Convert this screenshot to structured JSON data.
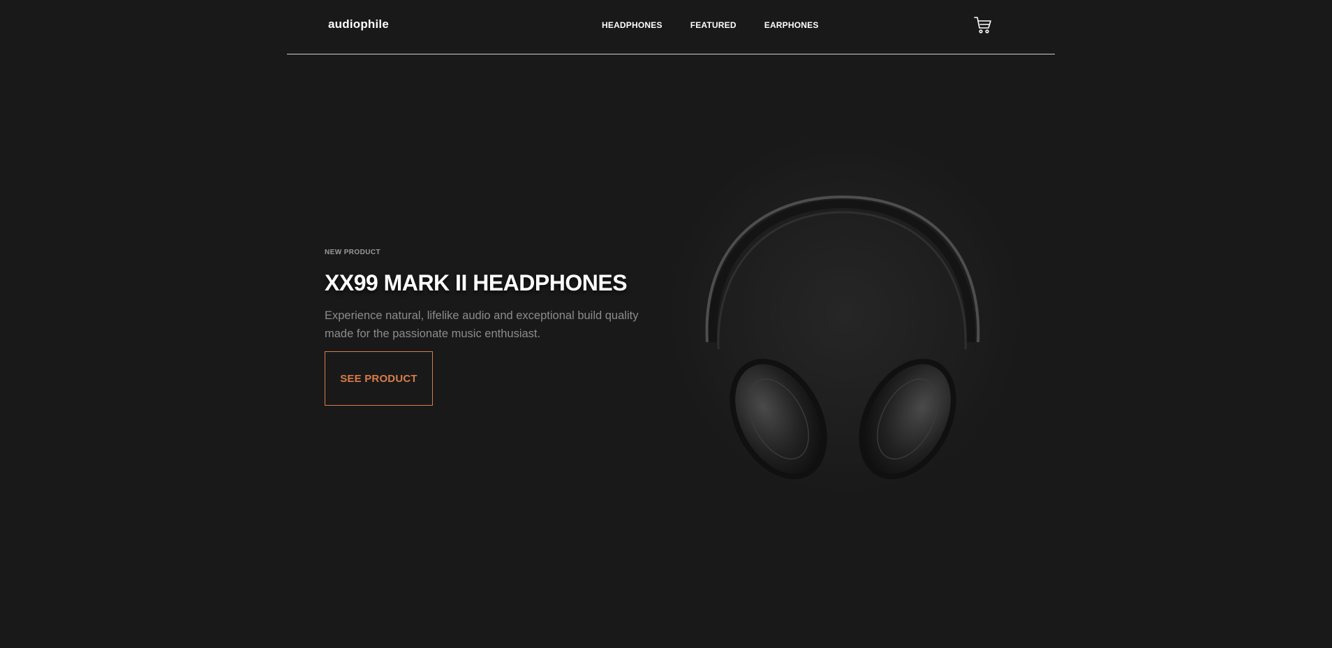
{
  "header": {
    "logo": "audiophile",
    "nav": [
      {
        "label": "HEADPHONES"
      },
      {
        "label": "FEATURED"
      },
      {
        "label": "EARPHONES"
      }
    ],
    "cart_icon": "shopping-cart-icon"
  },
  "hero": {
    "overline": "NEW PRODUCT",
    "title": "XX99 MARK II HEADPHONES",
    "description": "Experience natural, lifelike audio and exceptional build quality made for the passionate music enthusiast.",
    "cta_label": "SEE PRODUCT",
    "image_icon": "headphones-image"
  },
  "colors": {
    "background": "#191919",
    "accent": "#d87d4a",
    "muted_text": "#8c8c8c",
    "divider": "#cfcfcf"
  }
}
